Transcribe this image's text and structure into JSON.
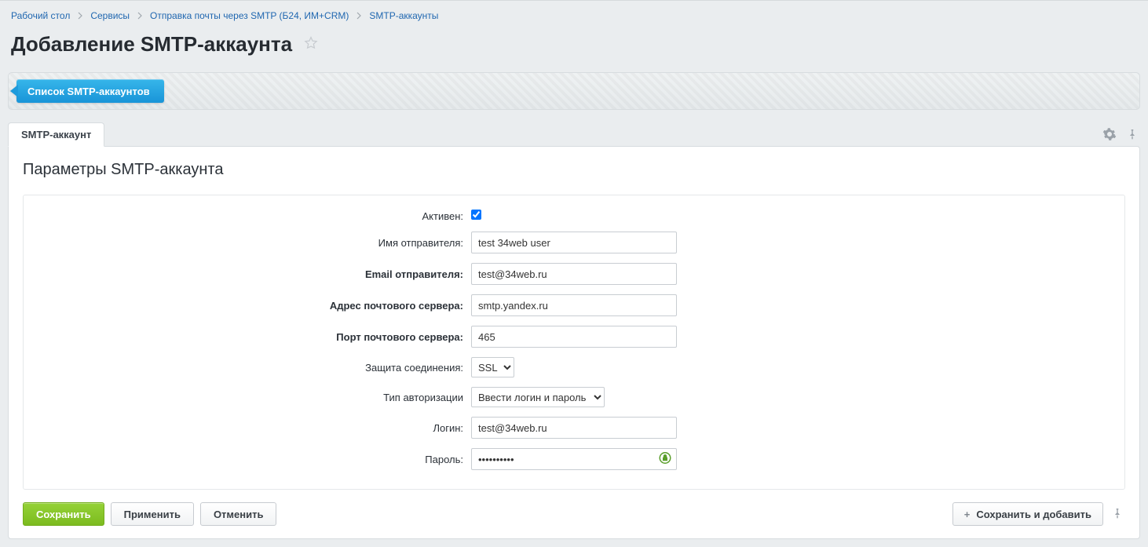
{
  "breadcrumbs": [
    "Рабочий стол",
    "Сервисы",
    "Отправка почты через SMTP (Б24, ИМ+CRM)",
    "SMTP-аккаунты"
  ],
  "page_title": "Добавление SMTP-аккаунта",
  "top_button": "Список SMTP-аккаунтов",
  "tab_label": "SMTP-аккаунт",
  "section_title": "Параметры SMTP-аккаунта",
  "form": {
    "active_label": "Активен:",
    "active_checked": true,
    "sender_name_label": "Имя отправителя:",
    "sender_name_value": "test 34web user",
    "sender_email_label": "Email отправителя:",
    "sender_email_value": "test@34web.ru",
    "server_label": "Адрес почтового сервера:",
    "server_value": "smtp.yandex.ru",
    "port_label": "Порт почтового сервера:",
    "port_value": "465",
    "secure_label": "Защита соединения:",
    "secure_value": "SSL",
    "auth_type_label": "Тип авторизации",
    "auth_type_value": "Ввести логин и пароль",
    "login_label": "Логин:",
    "login_value": "test@34web.ru",
    "password_label": "Пароль:",
    "password_value": "••••••••••"
  },
  "buttons": {
    "save": "Сохранить",
    "apply": "Применить",
    "cancel": "Отменить",
    "save_add": "Сохранить и добавить"
  }
}
